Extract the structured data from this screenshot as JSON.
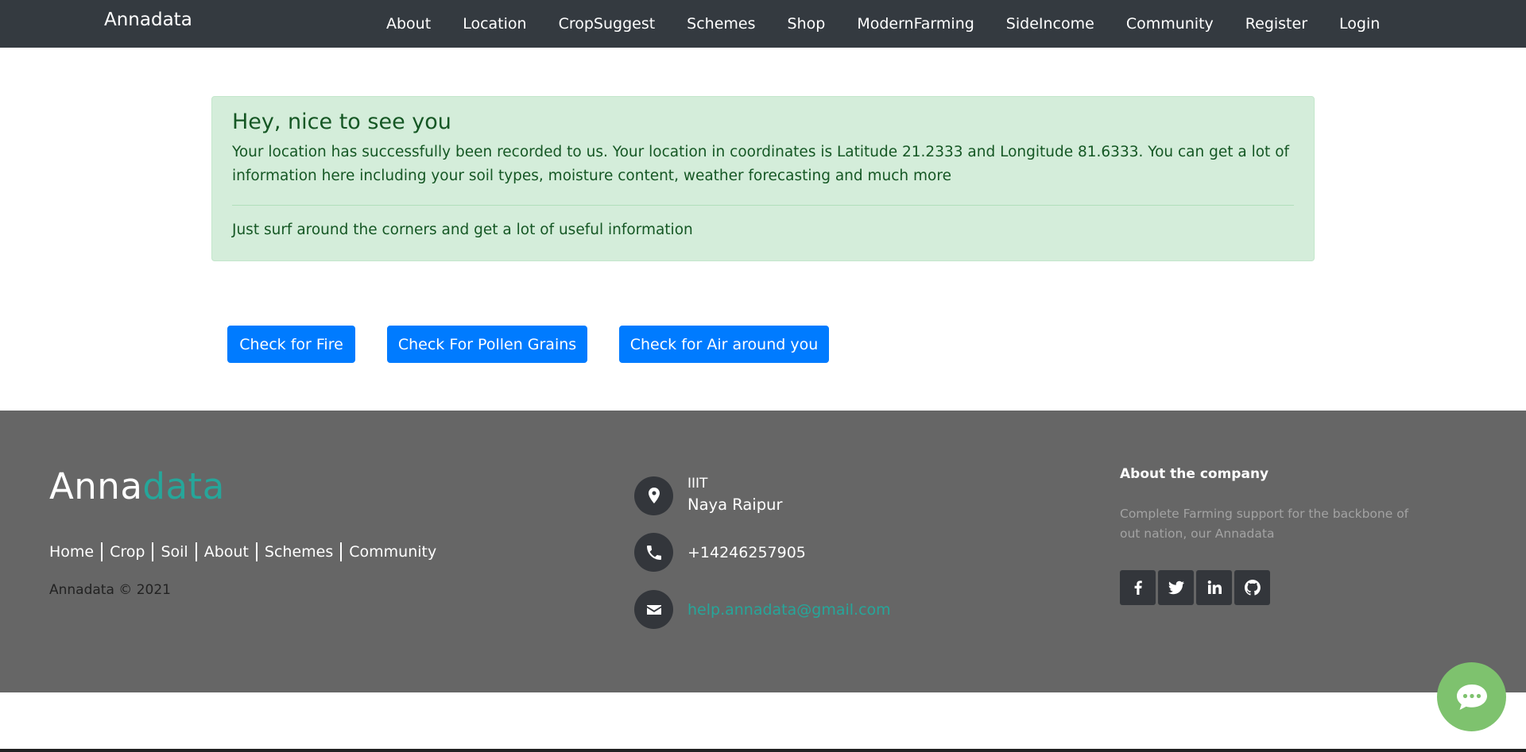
{
  "navbar": {
    "brand": "Annadata",
    "links": [
      "About",
      "Location",
      "CropSuggest",
      "Schemes",
      "Shop",
      "ModernFarming",
      "SideIncome",
      "Community",
      "Register",
      "Login"
    ]
  },
  "alert": {
    "heading": "Hey, nice to see you",
    "text": "Your location has successfully been recorded to us. Your location in coordinates is Latitude 21.2333 and Longitude 81.6333. You can get a lot of information here including your soil types, moisture content, weather forecasting and much more",
    "footer": "Just surf around the corners and get a lot of useful information"
  },
  "actions": {
    "fire": "Check for Fire",
    "pollen": "Check For Pollen Grains",
    "air": "Check for Air around you"
  },
  "footer": {
    "logo_part1": "Anna",
    "logo_part2": "data",
    "links": [
      "Home",
      "Crop",
      "Soil",
      "About",
      "Schemes",
      "Community"
    ],
    "copyright": "Annadata © 2021",
    "address_line1": "IIIT",
    "address_line2": "Naya Raipur",
    "phone": "+14246257905",
    "email": "help.annadata@gmail.com",
    "about_title": "About the company",
    "about_text": "Complete Farming support for the backbone of out nation, our Annadata",
    "social_icons": [
      "facebook-icon",
      "twitter-icon",
      "linkedin-icon",
      "github-icon"
    ]
  },
  "colors": {
    "navbar_bg": "#343a40",
    "alert_bg": "#d4edda",
    "alert_text": "#155724",
    "button_primary": "#007bff",
    "footer_bg": "#666666",
    "accent_teal": "#26a69a",
    "chat_bubble": "#7ec26e"
  }
}
